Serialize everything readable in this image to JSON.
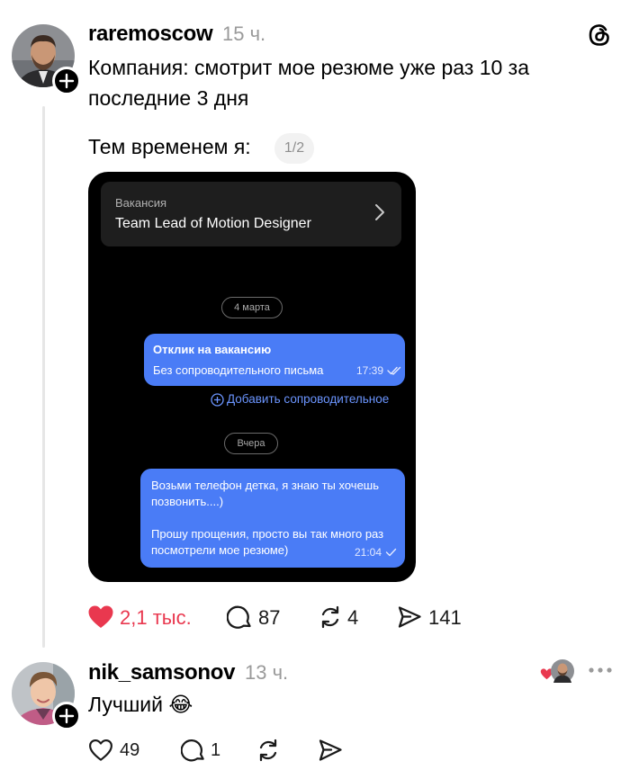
{
  "post": {
    "username": "raremoscow",
    "time": "15 ч.",
    "text_line1": "Компания: смотрит мое резюме уже раз 10 за",
    "text_line2": "последние 3 дня",
    "text_line3": "Тем временем я:",
    "page_indicator": "1/2",
    "screenshot": {
      "vacancy_label": "Вакансия",
      "vacancy_title": "Team Lead of Motion Designer",
      "date1": "4 марта",
      "bubble1_title": "Отклик на вакансию",
      "bubble1_text": "Без сопроводительного письма",
      "bubble1_time": "17:39",
      "add_cover": "Добавить сопроводительное",
      "date2": "Вчера",
      "bubble2_text": "Возьми телефон детка, я знаю ты хочешь позвонить....)\n\nПрошу прощения, просто вы так много раз посмотрели мое резюме)",
      "bubble2_time": "21:04"
    },
    "actions": {
      "likes": "2,1 тыс.",
      "comments": "87",
      "reposts": "4",
      "shares": "141"
    },
    "liked": true
  },
  "reply": {
    "username": "nik_samsonov",
    "time": "13 ч.",
    "text": "Лучший 😂",
    "actions": {
      "likes": "49",
      "comments": "1"
    },
    "liked_by_author": true
  },
  "colors": {
    "like_red": "#e9384f",
    "bubble_blue": "#4a7cf6",
    "link_blue": "#6b95ff"
  },
  "icons": [
    "threads-logo-icon",
    "plus-icon",
    "chevron-right-icon",
    "double-check-icon",
    "check-icon",
    "plus-circle-icon",
    "heart-icon",
    "comment-icon",
    "repost-icon",
    "share-icon",
    "more-icon"
  ]
}
